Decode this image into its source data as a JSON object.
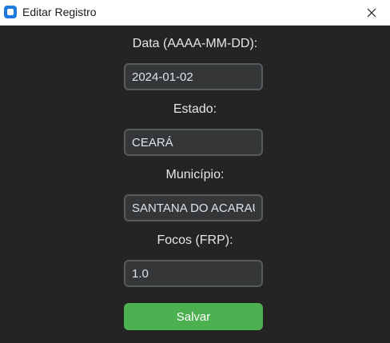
{
  "window": {
    "title": "Editar Registro",
    "app_icon": "app-icon",
    "close_icon": "close-icon"
  },
  "form": {
    "date_label": "Data (AAAA-MM-DD):",
    "date_value": "2024-01-02",
    "state_label": "Estado:",
    "state_value": "CEARÁ",
    "municipality_label": "Município:",
    "municipality_value": "SANTANA DO ACARAÚ",
    "focos_label": "Focos (FRP):",
    "focos_value": "1.0",
    "save_label": "Salvar"
  },
  "colors": {
    "background": "#242424",
    "field_background": "#343638",
    "field_border": "#565b5e",
    "button": "#4caf50",
    "text": "#e6e6e6"
  }
}
